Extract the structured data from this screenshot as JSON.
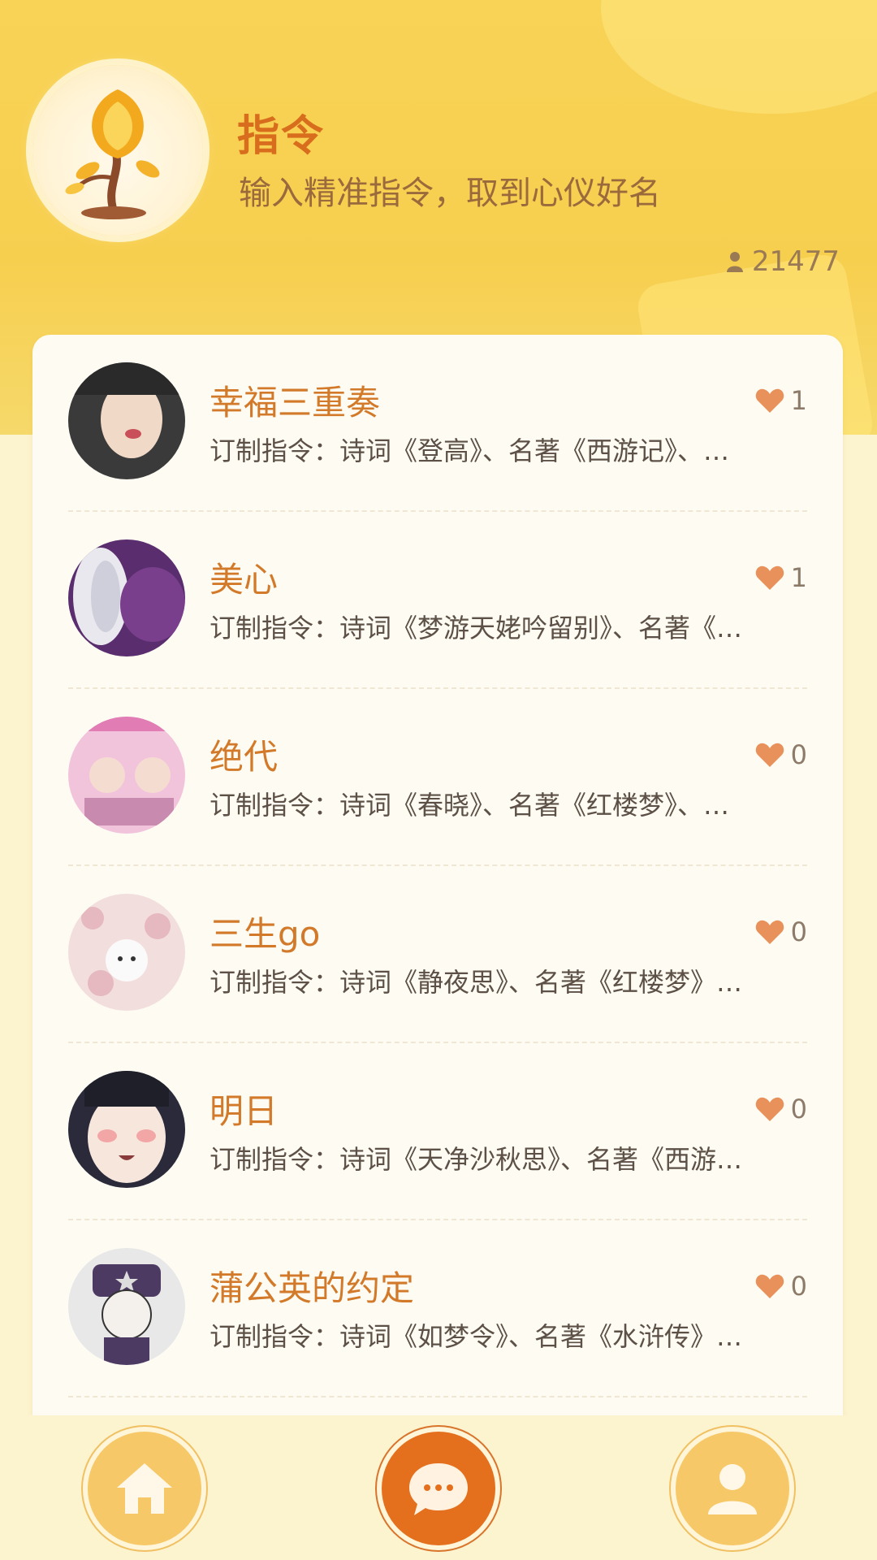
{
  "header": {
    "title": "指令",
    "subtitle": "输入精准指令，取到心仪好名",
    "count": "21477"
  },
  "items": [
    {
      "name": "幸福三重奏",
      "desc": "订制指令：诗词《登高》、名著《西游记》、…",
      "likes": "1",
      "avatar_colors": [
        "#3a3a3a",
        "#f1d9c8"
      ]
    },
    {
      "name": "美心",
      "desc": "订制指令：诗词《梦游天姥吟留别》、名著《…",
      "likes": "1",
      "avatar_colors": [
        "#5a2d6e",
        "#e8e8ee"
      ]
    },
    {
      "name": "绝代",
      "desc": "订制指令：诗词《春晓》、名著《红楼梦》、…",
      "likes": "0",
      "avatar_colors": [
        "#f2c4dc",
        "#9a6b8c"
      ]
    },
    {
      "name": "三生go",
      "desc": "订制指令：诗词《静夜思》、名著《红楼梦》…",
      "likes": "0",
      "avatar_colors": [
        "#f3dede",
        "#c9a0a8"
      ]
    },
    {
      "name": "明日",
      "desc": "订制指令：诗词《天净沙秋思》、名著《西游…",
      "likes": "0",
      "avatar_colors": [
        "#2a2a3a",
        "#f6e6dc"
      ]
    },
    {
      "name": "蒲公英的约定",
      "desc": "订制指令：诗词《如梦令》、名著《水浒传》…",
      "likes": "0",
      "avatar_colors": [
        "#e8e8e8",
        "#4c3a63"
      ]
    }
  ],
  "nav": {
    "home_icon": "home-icon",
    "chat_icon": "chat-icon",
    "user_icon": "user-icon"
  },
  "colors": {
    "accent": "#e4701e",
    "header_yellow": "#f8d356",
    "heart": "#e8915a"
  }
}
